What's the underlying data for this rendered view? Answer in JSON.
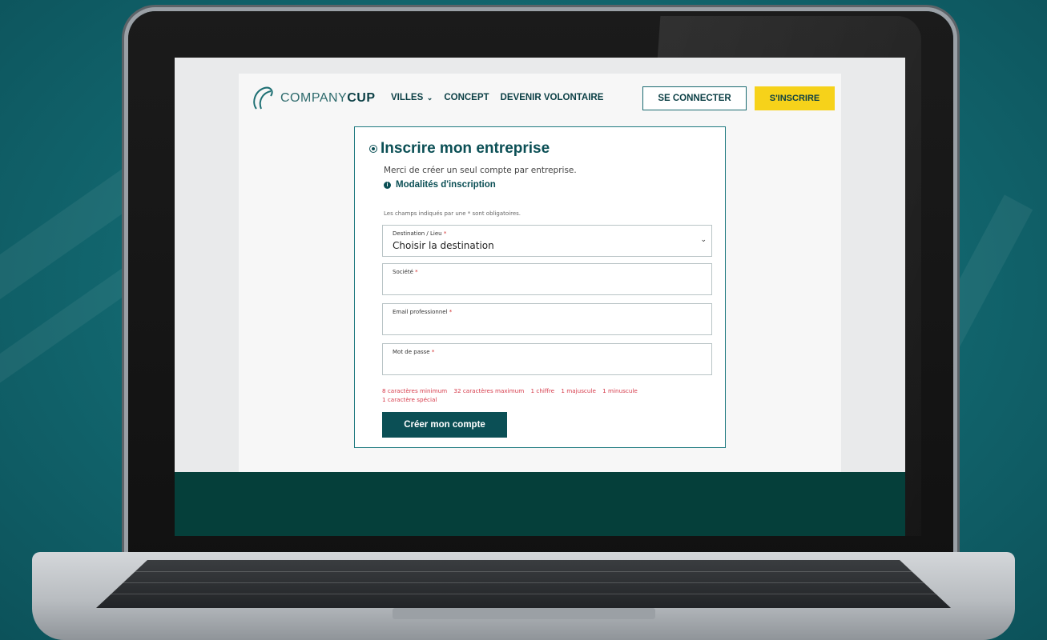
{
  "header": {
    "logo_light": "COMPANY",
    "logo_bold": "CUP",
    "nav": [
      {
        "label": "VILLES",
        "has_dropdown": true
      },
      {
        "label": "CONCEPT",
        "has_dropdown": false
      },
      {
        "label": "DEVENIR VOLONTAIRE",
        "has_dropdown": false
      }
    ],
    "login_label": "SE CONNECTER",
    "signup_label": "S'INSCRIRE"
  },
  "form": {
    "title": "Inscrire mon entreprise",
    "subtitle": "Merci de créer un seul compte par entreprise.",
    "modalites_link": "Modalités d'inscription",
    "required_note": "Les champs indiqués par une * sont obligatoires.",
    "fields": {
      "destination": {
        "label": "Destination / Lieu",
        "value": "Choisir la destination"
      },
      "societe": {
        "label": "Société",
        "value": ""
      },
      "email": {
        "label": "Email professionnel",
        "value": ""
      },
      "password": {
        "label": "Mot de passe",
        "value": ""
      }
    },
    "password_rules": [
      "8 caractères minimum",
      "32 caractères maximum",
      "1 chiffre",
      "1 majuscule",
      "1 minuscule",
      "1 caractère spécial"
    ],
    "submit_label": "Créer mon compte"
  },
  "colors": {
    "brand_teal": "#0b4f55",
    "accent_yellow": "#f6d21a",
    "footer_dark": "#053f3a",
    "error_red": "#d63b4b"
  }
}
